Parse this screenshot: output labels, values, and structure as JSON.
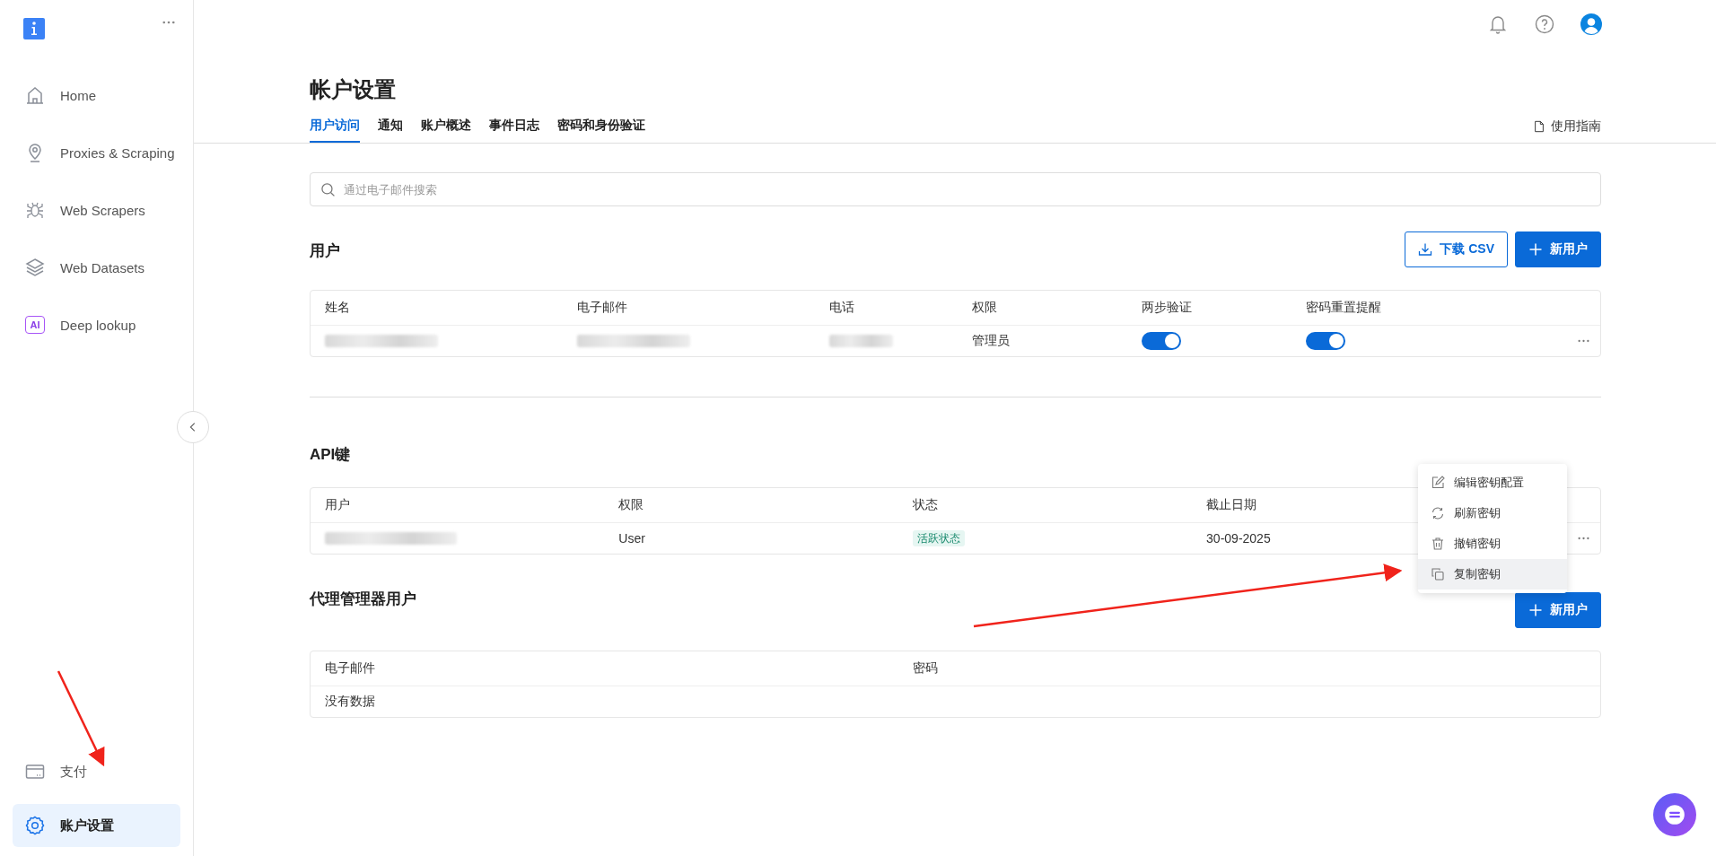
{
  "sidebar": {
    "items": [
      {
        "label": "Home",
        "selected": false
      },
      {
        "label": "Proxies & Scraping",
        "selected": false
      },
      {
        "label": "Web Scrapers",
        "selected": false
      },
      {
        "label": "Web Datasets",
        "selected": false
      },
      {
        "label": "Deep lookup",
        "badge": "AI",
        "selected": false
      }
    ],
    "bottom_items": [
      {
        "label": "支付",
        "selected": false
      },
      {
        "label": "账户设置",
        "selected": true
      }
    ]
  },
  "page": {
    "title": "帐户设置",
    "guide_link": "使用指南",
    "tabs": [
      {
        "label": "用户访问",
        "selected": true
      },
      {
        "label": "通知",
        "selected": false
      },
      {
        "label": "账户概述",
        "selected": false
      },
      {
        "label": "事件日志",
        "selected": false
      },
      {
        "label": "密码和身份验证",
        "selected": false
      }
    ],
    "search": {
      "placeholder": "通过电子邮件搜索"
    }
  },
  "users": {
    "title": "用户",
    "buttons": [
      {
        "label": "下载 CSV",
        "kind": "outline"
      },
      {
        "label": "新用户",
        "kind": "primary"
      }
    ],
    "columns": [
      "姓名",
      "电子邮件",
      "电话",
      "权限",
      "两步验证",
      "密码重置提醒"
    ],
    "rows": [
      {
        "name": {
          "kind": "redacted"
        },
        "email": {
          "kind": "redacted"
        },
        "phone": {
          "kind": "redacted"
        },
        "role": "管理员",
        "two_step": {
          "on": true
        },
        "reset_reminder": {
          "on": true
        }
      }
    ]
  },
  "api_keys": {
    "title": "API键",
    "columns": [
      "用户",
      "权限",
      "状态",
      "截止日期"
    ],
    "rows": [
      {
        "user": {
          "kind": "redacted"
        },
        "role": "User",
        "status": "活跃状态",
        "expiry": "30-09-2025"
      }
    ],
    "menu": [
      {
        "label": "编辑密钥配置",
        "selected": false
      },
      {
        "label": "刷新密钥",
        "selected": false
      },
      {
        "label": "撤销密钥",
        "selected": false
      },
      {
        "label": "复制密钥",
        "selected": true
      }
    ]
  },
  "proxy_users": {
    "title": "代理管理器用户",
    "button": "新用户",
    "columns": [
      "电子邮件",
      "密码"
    ],
    "empty": "没有数据"
  }
}
